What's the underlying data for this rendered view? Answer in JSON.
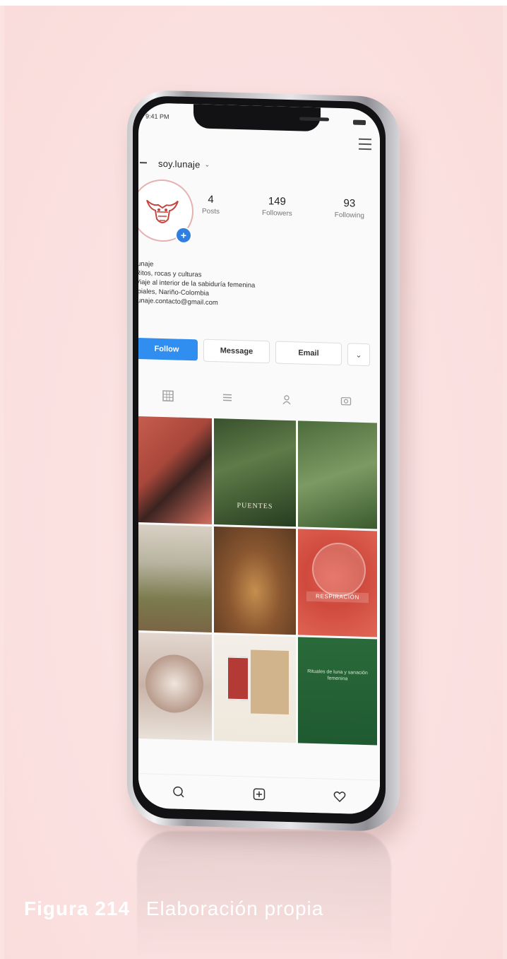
{
  "status": {
    "time": "9:41 PM"
  },
  "profile": {
    "username": "soy.lunaje",
    "stats": [
      {
        "value": "4",
        "label": "Posts"
      },
      {
        "value": "149",
        "label": "Followers"
      },
      {
        "value": "93",
        "label": "Following"
      }
    ],
    "bio": [
      "lunaje",
      "Ritos, rocas y culturas",
      "Viaje al interior de la sabiduría femenina",
      "Ipiales, Nariño-Colombia",
      "lunaje.contacto@gmail.com"
    ]
  },
  "actions": {
    "follow": "Follow",
    "message": "Message",
    "email": "Email",
    "more": "⌄"
  },
  "tiles": {
    "t2_text": "PUENTES",
    "t6_text": "RESPIRACIÓN",
    "t9_text": "Rituales de luna y sanación femenina"
  },
  "caption": {
    "label": "Figura 214",
    "text": "Elaboración propia"
  },
  "colors": {
    "background": "#fbe3e2",
    "follow_button": "#2f8ef0",
    "avatar_plus": "#2f7fe0"
  }
}
